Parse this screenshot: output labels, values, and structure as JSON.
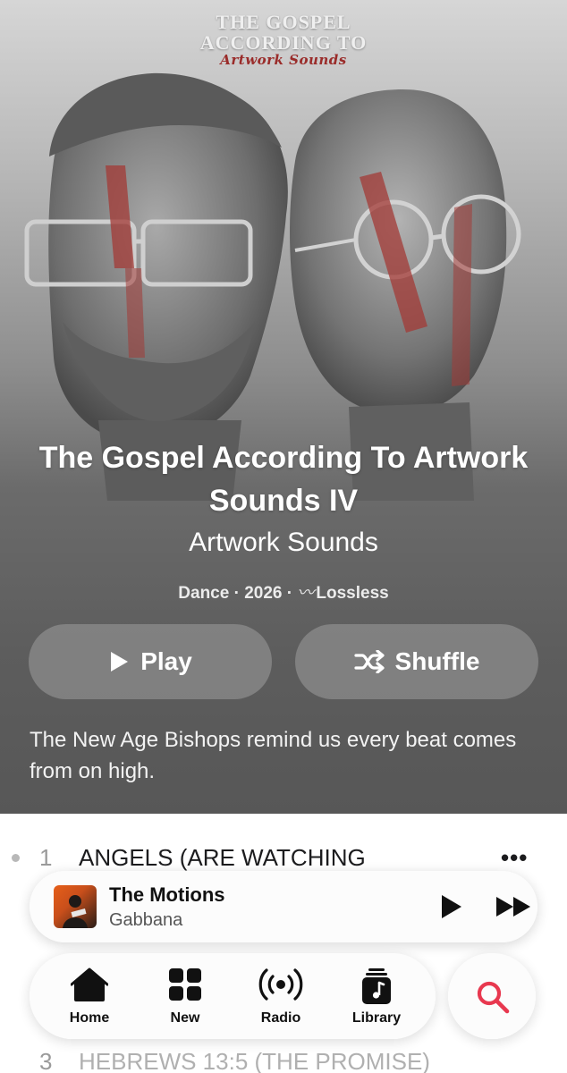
{
  "cover_art": {
    "line1": "THE GOSPEL",
    "line2": "ACCORDING TO",
    "line3": "Artwork Sounds"
  },
  "album": {
    "title": "The Gospel According To Artwork Sounds IV",
    "artist": "Artwork Sounds",
    "genre": "Dance",
    "year": "2026",
    "quality": "Lossless",
    "meta_separator": "·",
    "description": "The New Age Bishops remind us every beat comes from on high."
  },
  "actions": {
    "play_label": "Play",
    "shuffle_label": "Shuffle"
  },
  "tracks": [
    {
      "number": "1",
      "title": "ANGELS (ARE WATCHING",
      "more": "•••"
    },
    {
      "number": "3",
      "title": "HEBREWS 13:5 (THE PROMISE)",
      "more": "•••"
    }
  ],
  "now_playing": {
    "title": "The Motions",
    "artist": "Gabbana"
  },
  "tabs": [
    {
      "label": "Home",
      "icon": "house-icon"
    },
    {
      "label": "New",
      "icon": "grid-icon"
    },
    {
      "label": "Radio",
      "icon": "broadcast-icon"
    },
    {
      "label": "Library",
      "icon": "music-library-icon"
    }
  ],
  "colors": {
    "accent": "#e8384f",
    "cover_red": "#9a2c2a",
    "button_bg": "#969696"
  }
}
